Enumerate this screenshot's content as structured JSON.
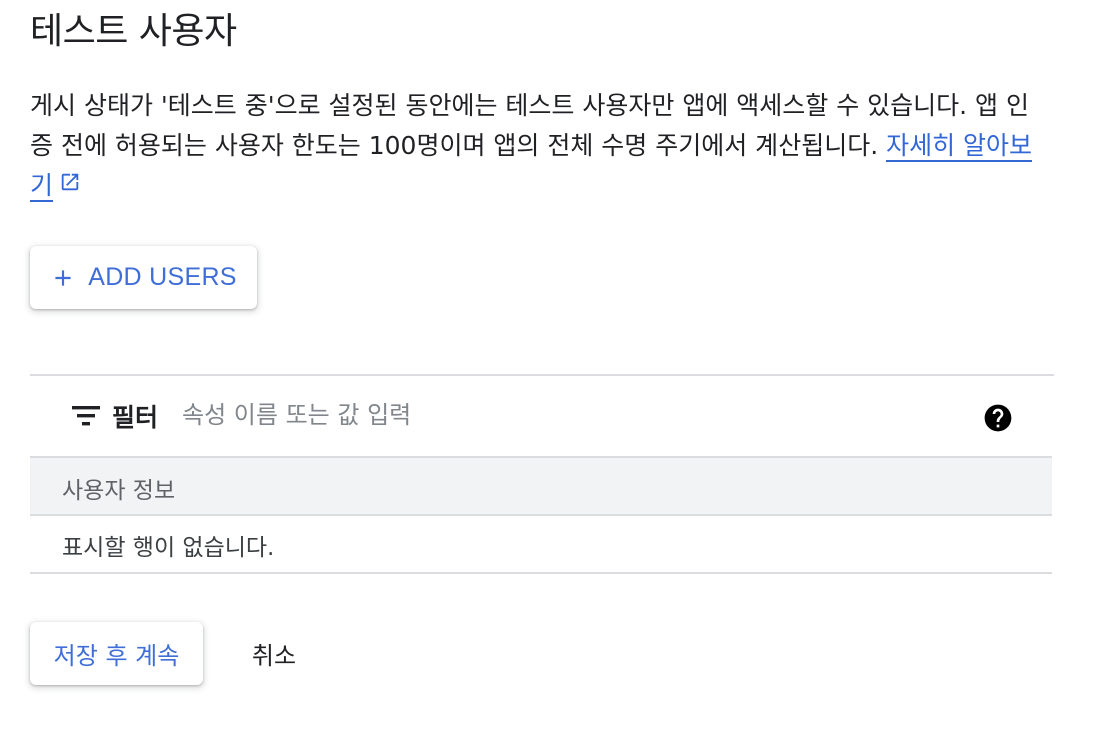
{
  "page": {
    "title": "테스트 사용자",
    "description": "게시 상태가 '테스트 중'으로 설정된 동안에는 테스트 사용자만 앱에 액세스할 수 있습니다. 앱 인증 전에 허용되는 사용자 한도는 100명이며 앱의 전체 수명 주기에서 계산됩니다. ",
    "learn_more_link": "자세히 알아보기"
  },
  "toolbar": {
    "add_users_label": "ADD USERS"
  },
  "filter": {
    "label": "필터",
    "placeholder": "속성 이름 또는 값 입력",
    "value": ""
  },
  "table": {
    "columns": [
      "사용자 정보"
    ],
    "rows": [],
    "empty_message": "표시할 행이 없습니다."
  },
  "actions": {
    "save_continue_label": "저장 후 계속",
    "cancel_label": "취소"
  },
  "colors": {
    "accent": "#3f6ed8",
    "link": "#3367d6",
    "text": "#202124",
    "muted": "#5f6368",
    "divider": "#dadce0",
    "header_bg": "#f1f3f4"
  },
  "icons": {
    "add": "plus-icon",
    "external": "open-in-new-icon",
    "filter": "filter-list-icon",
    "help": "help-circle-icon"
  }
}
